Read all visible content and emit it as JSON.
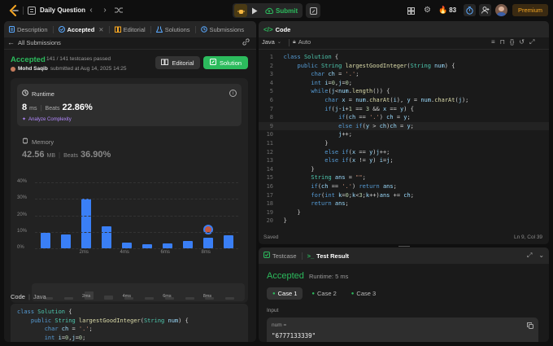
{
  "top": {
    "problem_label": "Daily Question",
    "submit": "Submit",
    "streak": "83",
    "premium": "Premium"
  },
  "left": {
    "tabs": [
      {
        "label": "Description"
      },
      {
        "label": "Accepted"
      },
      {
        "label": "Editorial"
      },
      {
        "label": "Solutions"
      },
      {
        "label": "Submissions"
      }
    ],
    "all_submissions": "All Submissions",
    "status": "Accepted",
    "testcases": "141 / 141 testcases passed",
    "user": "Mohd Saqib",
    "submitted": "submitted at Aug 14, 2025 14:25",
    "editorial_btn": "Editorial",
    "solution_btn": "Solution",
    "runtime": {
      "title": "Runtime",
      "value": "8",
      "unit": "ms",
      "beats_label": "Beats",
      "beats": "22.86%",
      "analyze": "Analyze Complexity"
    },
    "memory": {
      "title": "Memory",
      "value": "42.56",
      "unit": "MB",
      "beats_label": "Beats",
      "beats": "36.90%"
    },
    "code_label": "Code",
    "lang": "Java",
    "code": [
      "class Solution {",
      "    public String largestGoodInteger(String num) {",
      "        char ch = '.';",
      "        int i=0,j=0;"
    ]
  },
  "chart_data": {
    "type": "bar",
    "yticks": [
      "40%",
      "30%",
      "20%",
      "10%",
      "0%"
    ],
    "ylim": [
      0,
      40
    ],
    "xlabels": [
      "2ms",
      "4ms",
      "6ms",
      "8ms"
    ],
    "values": [
      9.5,
      8.5,
      30,
      13.5,
      3.5,
      2.5,
      3,
      4.5,
      6.5,
      8
    ],
    "highlight_index": 8,
    "mini_xlabels": [
      "2ms",
      "4ms",
      "6ms",
      "8ms"
    ]
  },
  "editor": {
    "title": "Code",
    "lang": "Java",
    "mode": "Auto",
    "saved": "Saved",
    "cursor": "Ln 9, Col 39",
    "lines": [
      "class Solution {",
      "    public String largestGoodInteger(String num) {",
      "        char ch = '.';",
      "        int i=0,j=0;",
      "        while(j<num.length()) {",
      "            char x = num.charAt(i), y = num.charAt(j);",
      "            if(j-i+1 == 3 && x == y) {",
      "                if(ch == '.') ch = y;",
      "                else if(y > ch)ch = y;",
      "                j++;",
      "            }",
      "            else if(x == y)j++;",
      "            else if(x != y) i=j;",
      "        }",
      "        String ans = \"\";",
      "        if(ch == '.') return ans;",
      "        for(int k=0;k<3;k++)ans += ch;",
      "        return ans;",
      "    }",
      "}"
    ]
  },
  "result": {
    "tab_testcase": "Testcase",
    "tab_result": "Test Result",
    "status": "Accepted",
    "runtime": "Runtime: 5 ms",
    "cases": [
      "Case 1",
      "Case 2",
      "Case 3"
    ],
    "input_label": "Input",
    "var": "num =",
    "value": "\"6777133339\""
  }
}
